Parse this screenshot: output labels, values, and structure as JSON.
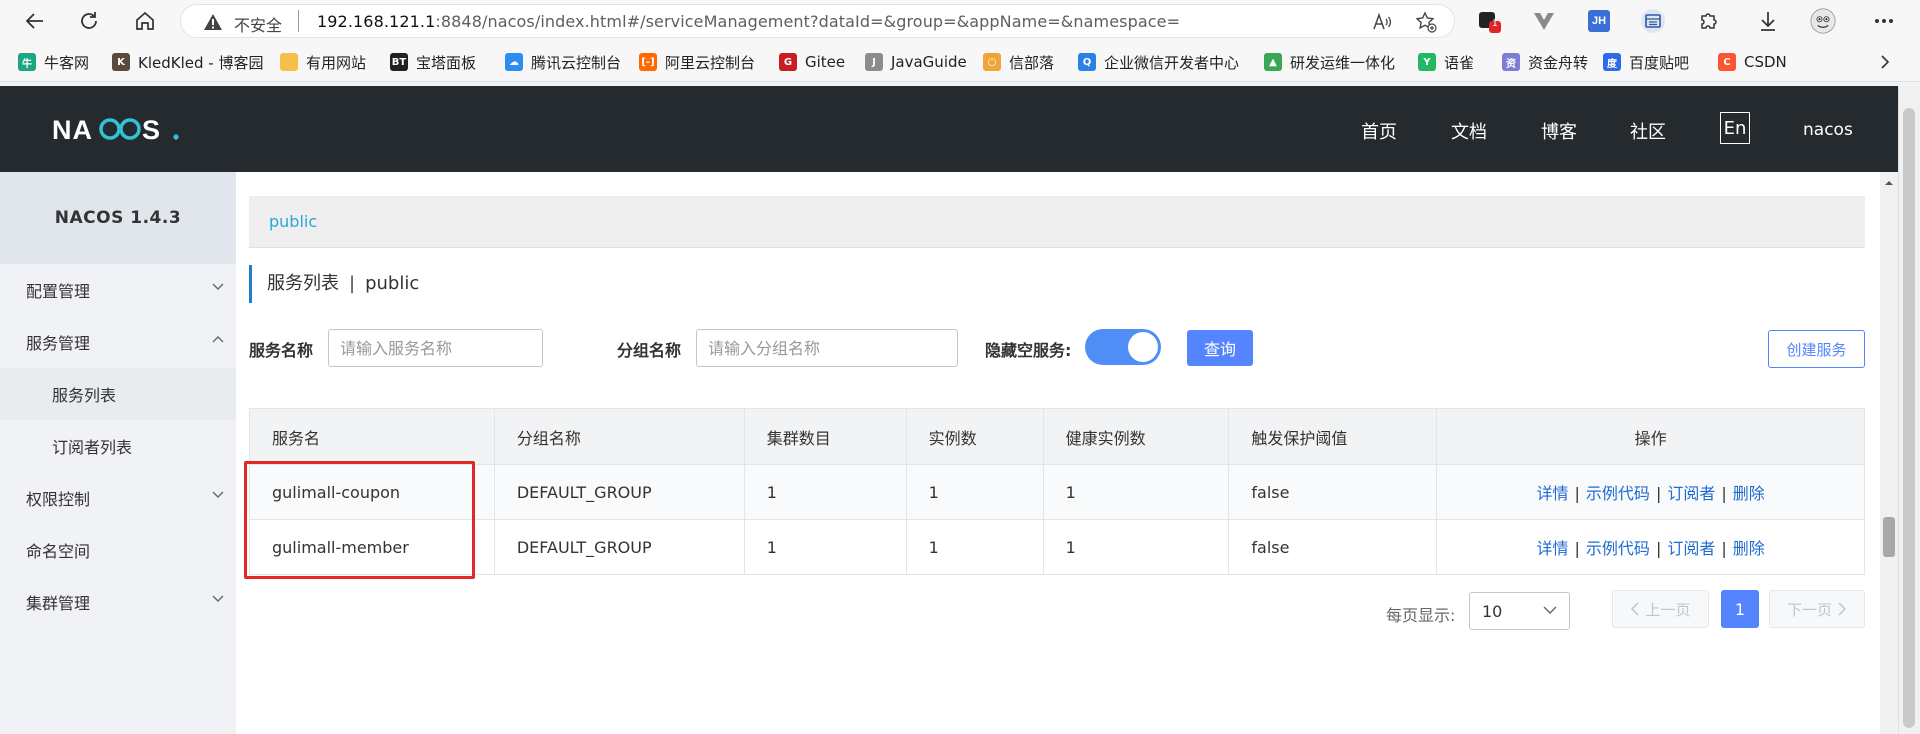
{
  "browser": {
    "insecure_label": "不安全",
    "url_host": "192.168.121.1",
    "url_rest": ":8848/nacos/index.html#/serviceManagement?dataId=&group=&appName=&namespace=",
    "ext_badge": "1",
    "ext_jh": "JH",
    "bookmarks": [
      {
        "label": "牛客网",
        "icon": "niuke-icon",
        "color": "#1ba784",
        "glyph": "牛"
      },
      {
        "label": "KledKled - 博客园",
        "icon": "kled-avatar-icon",
        "color": "#5a4a3a",
        "glyph": "K"
      },
      {
        "label": "有用网站",
        "icon": "folder-icon",
        "color": "#f5c04a",
        "glyph": ""
      },
      {
        "label": "宝塔面板",
        "icon": "bt-icon",
        "color": "#222222",
        "glyph": "BT"
      },
      {
        "label": "腾讯云控制台",
        "icon": "tencent-cloud-icon",
        "color": "#2d8cf0",
        "glyph": "☁"
      },
      {
        "label": "阿里云控制台",
        "icon": "aliyun-icon",
        "color": "#ff6a00",
        "glyph": "[-]"
      },
      {
        "label": "Gitee",
        "icon": "gitee-icon",
        "color": "#c71d23",
        "glyph": "G"
      },
      {
        "label": "JavaGuide",
        "icon": "javaguide-icon",
        "color": "#8c8c8c",
        "glyph": "J"
      },
      {
        "label": "信部落",
        "icon": "xinbuluo-icon",
        "color": "#f1a33c",
        "glyph": "○"
      },
      {
        "label": "企业微信开发者中心",
        "icon": "wecom-icon",
        "color": "#2b82e6",
        "glyph": "Q"
      },
      {
        "label": "研发运维一体化",
        "icon": "devops-icon",
        "color": "#3aa757",
        "glyph": "▲"
      },
      {
        "label": "语雀",
        "icon": "yuque-icon",
        "color": "#25b864",
        "glyph": "Y"
      },
      {
        "label": "资金舟转",
        "icon": "zijin-icon",
        "color": "#7d7dd6",
        "glyph": "资"
      },
      {
        "label": "百度贴吧",
        "icon": "baidu-tieba-icon",
        "color": "#2d6be8",
        "glyph": "度"
      },
      {
        "label": "CSDN",
        "icon": "csdn-icon",
        "color": "#fc5531",
        "glyph": "C"
      }
    ]
  },
  "header": {
    "logo": "NACOS.",
    "nav": [
      "首页",
      "文档",
      "博客",
      "社区"
    ],
    "lang": "En",
    "user": "nacos",
    "colors": {
      "bg": "#252a2f",
      "logo_accent": "#2ec4d6"
    }
  },
  "sidebar": {
    "version": "NACOS 1.4.3",
    "items": [
      {
        "label": "配置管理",
        "expanded": false
      },
      {
        "label": "服务管理",
        "expanded": true
      },
      {
        "label": "服务列表",
        "sub": true
      },
      {
        "label": "订阅者列表",
        "sub": true
      },
      {
        "label": "权限控制",
        "expanded": false
      },
      {
        "label": "命名空间"
      },
      {
        "label": "集群管理",
        "expanded": false
      }
    ]
  },
  "main": {
    "namespace": "public",
    "title": "服务列表",
    "title_sep": "|",
    "title_ns": "public",
    "filters": {
      "service_label": "服务名称",
      "service_placeholder": "请输入服务名称",
      "group_label": "分组名称",
      "group_placeholder": "请输入分组名称",
      "hide_empty_label": "隐藏空服务:",
      "hide_empty_on": true
    },
    "query_button": "查询",
    "create_button": "创建服务",
    "table": {
      "columns": [
        "服务名",
        "分组名称",
        "集群数目",
        "实例数",
        "健康实例数",
        "触发保护阈值",
        "操作"
      ],
      "rows": [
        [
          "gulimall-coupon",
          "DEFAULT_GROUP",
          "1",
          "1",
          "1",
          "false"
        ],
        [
          "gulimall-member",
          "DEFAULT_GROUP",
          "1",
          "1",
          "1",
          "false"
        ]
      ],
      "actions": [
        "详情",
        "示例代码",
        "订阅者",
        "删除"
      ],
      "action_sep": "|"
    },
    "pagination": {
      "page_size_label": "每页显示:",
      "page_size": "10",
      "prev": "上一页",
      "next": "下一页",
      "current_page": "1"
    },
    "colors": {
      "primary": "#5584ff",
      "link": "#1e6ad2",
      "namespace": "#28a8d8",
      "highlight": "#e02a2a"
    }
  }
}
